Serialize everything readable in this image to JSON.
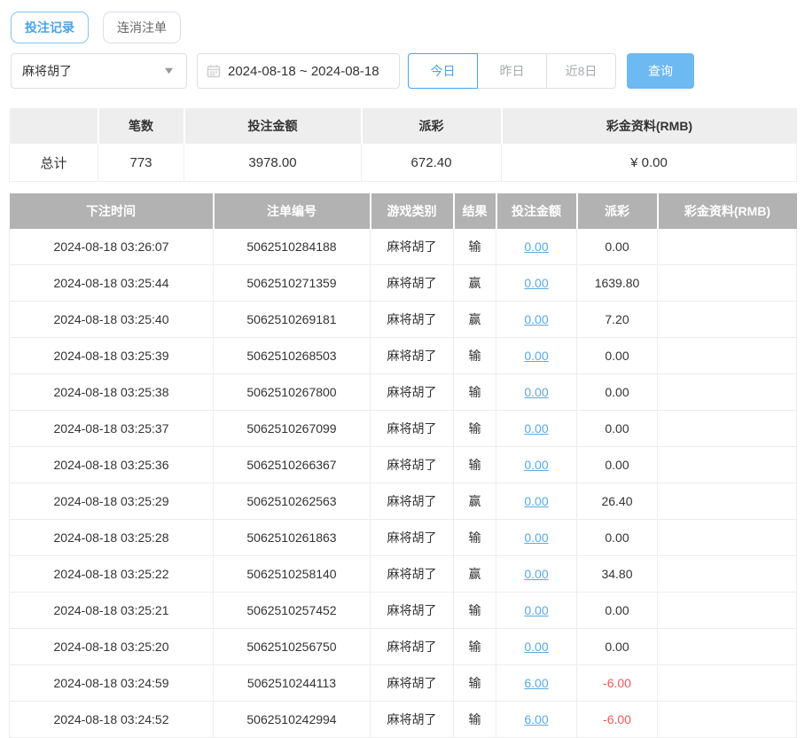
{
  "tabs": [
    {
      "label": "投注记录",
      "active": true
    },
    {
      "label": "连消注单",
      "active": false
    }
  ],
  "filters": {
    "game_select": {
      "value": "麻将胡了"
    },
    "date_range": {
      "value": "2024-08-18 ~ 2024-08-18"
    },
    "quick_ranges": [
      {
        "label": "今日",
        "active": true
      },
      {
        "label": "昨日",
        "active": false
      },
      {
        "label": "近8日",
        "active": false
      }
    ],
    "search_label": "查询"
  },
  "summary": {
    "headers": [
      "",
      "笔数",
      "投注金额",
      "派彩",
      "彩金资料(RMB)"
    ],
    "row": {
      "label": "总计",
      "count": "773",
      "bet_total": "3978.00",
      "payout_total": "672.40",
      "bonus_total": "¥ 0.00"
    }
  },
  "table": {
    "headers": [
      "下注时间",
      "注单编号",
      "游戏类别",
      "结果",
      "投注金额",
      "派彩",
      "彩金资料(RMB)"
    ],
    "rows": [
      {
        "time": "2024-08-18 03:26:07",
        "order": "5062510284188",
        "game": "麻将胡了",
        "result": "输",
        "bet": "0.00",
        "payout": "0.00",
        "bonus": ""
      },
      {
        "time": "2024-08-18 03:25:44",
        "order": "5062510271359",
        "game": "麻将胡了",
        "result": "赢",
        "bet": "0.00",
        "payout": "1639.80",
        "bonus": ""
      },
      {
        "time": "2024-08-18 03:25:40",
        "order": "5062510269181",
        "game": "麻将胡了",
        "result": "赢",
        "bet": "0.00",
        "payout": "7.20",
        "bonus": ""
      },
      {
        "time": "2024-08-18 03:25:39",
        "order": "5062510268503",
        "game": "麻将胡了",
        "result": "输",
        "bet": "0.00",
        "payout": "0.00",
        "bonus": ""
      },
      {
        "time": "2024-08-18 03:25:38",
        "order": "5062510267800",
        "game": "麻将胡了",
        "result": "输",
        "bet": "0.00",
        "payout": "0.00",
        "bonus": ""
      },
      {
        "time": "2024-08-18 03:25:37",
        "order": "5062510267099",
        "game": "麻将胡了",
        "result": "输",
        "bet": "0.00",
        "payout": "0.00",
        "bonus": ""
      },
      {
        "time": "2024-08-18 03:25:36",
        "order": "5062510266367",
        "game": "麻将胡了",
        "result": "输",
        "bet": "0.00",
        "payout": "0.00",
        "bonus": ""
      },
      {
        "time": "2024-08-18 03:25:29",
        "order": "5062510262563",
        "game": "麻将胡了",
        "result": "赢",
        "bet": "0.00",
        "payout": "26.40",
        "bonus": ""
      },
      {
        "time": "2024-08-18 03:25:28",
        "order": "5062510261863",
        "game": "麻将胡了",
        "result": "输",
        "bet": "0.00",
        "payout": "0.00",
        "bonus": ""
      },
      {
        "time": "2024-08-18 03:25:22",
        "order": "5062510258140",
        "game": "麻将胡了",
        "result": "赢",
        "bet": "0.00",
        "payout": "34.80",
        "bonus": ""
      },
      {
        "time": "2024-08-18 03:25:21",
        "order": "5062510257452",
        "game": "麻将胡了",
        "result": "输",
        "bet": "0.00",
        "payout": "0.00",
        "bonus": ""
      },
      {
        "time": "2024-08-18 03:25:20",
        "order": "5062510256750",
        "game": "麻将胡了",
        "result": "输",
        "bet": "0.00",
        "payout": "0.00",
        "bonus": ""
      },
      {
        "time": "2024-08-18 03:24:59",
        "order": "5062510244113",
        "game": "麻将胡了",
        "result": "输",
        "bet": "6.00",
        "payout": "-6.00",
        "bonus": ""
      },
      {
        "time": "2024-08-18 03:24:52",
        "order": "5062510242994",
        "game": "麻将胡了",
        "result": "输",
        "bet": "6.00",
        "payout": "-6.00",
        "bonus": ""
      }
    ]
  },
  "colors": {
    "accent_blue": "#4aa3e8",
    "search_button_bg": "#6db9f1",
    "link_blue": "#5ca9dd",
    "negative_red": "#ee5a5a",
    "table_header_bg": "#b2b2b2",
    "summary_header_bg": "#eeeeee"
  }
}
